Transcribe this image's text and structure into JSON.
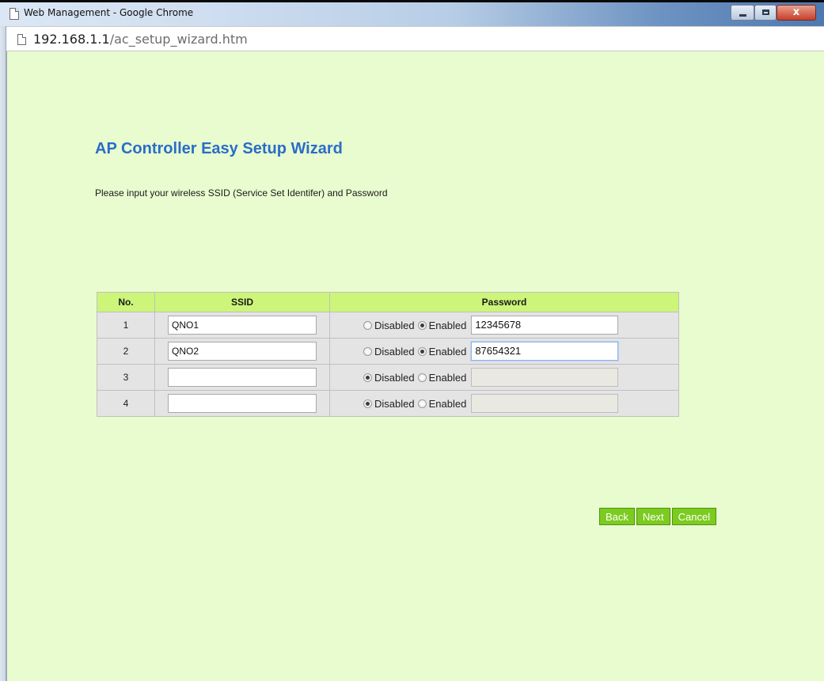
{
  "window": {
    "title": "Web Management - Google Chrome",
    "controls": {
      "minimize": "minimize-icon",
      "maximize": "maximize-icon",
      "close": "x"
    }
  },
  "address": {
    "host": "192.168.1.1",
    "path": "/ac_setup_wizard.htm"
  },
  "page": {
    "title": "AP Controller Easy Setup Wizard",
    "subtitle": "Please input your wireless SSID (Service Set Identifer) and Password"
  },
  "table": {
    "headers": {
      "no": "No.",
      "ssid": "SSID",
      "password": "Password"
    },
    "rows": [
      {
        "no": "1",
        "ssid": "QNO1",
        "mode": "Enabled",
        "password": "12345678",
        "focused": false
      },
      {
        "no": "2",
        "ssid": "QNO2",
        "mode": "Enabled",
        "password": "87654321",
        "focused": true
      },
      {
        "no": "3",
        "ssid": "",
        "mode": "Disabled",
        "password": "",
        "focused": false
      },
      {
        "no": "4",
        "ssid": "",
        "mode": "Disabled",
        "password": "",
        "focused": false
      }
    ],
    "radio_labels": {
      "disabled": "Disabled",
      "enabled": "Enabled"
    }
  },
  "buttons": {
    "back": "Back",
    "next": "Next",
    "cancel": "Cancel"
  },
  "colors": {
    "background": "#e8fccf",
    "header": "#ccf57a",
    "title": "#2a6cc9",
    "button": "#7ccb1f"
  }
}
